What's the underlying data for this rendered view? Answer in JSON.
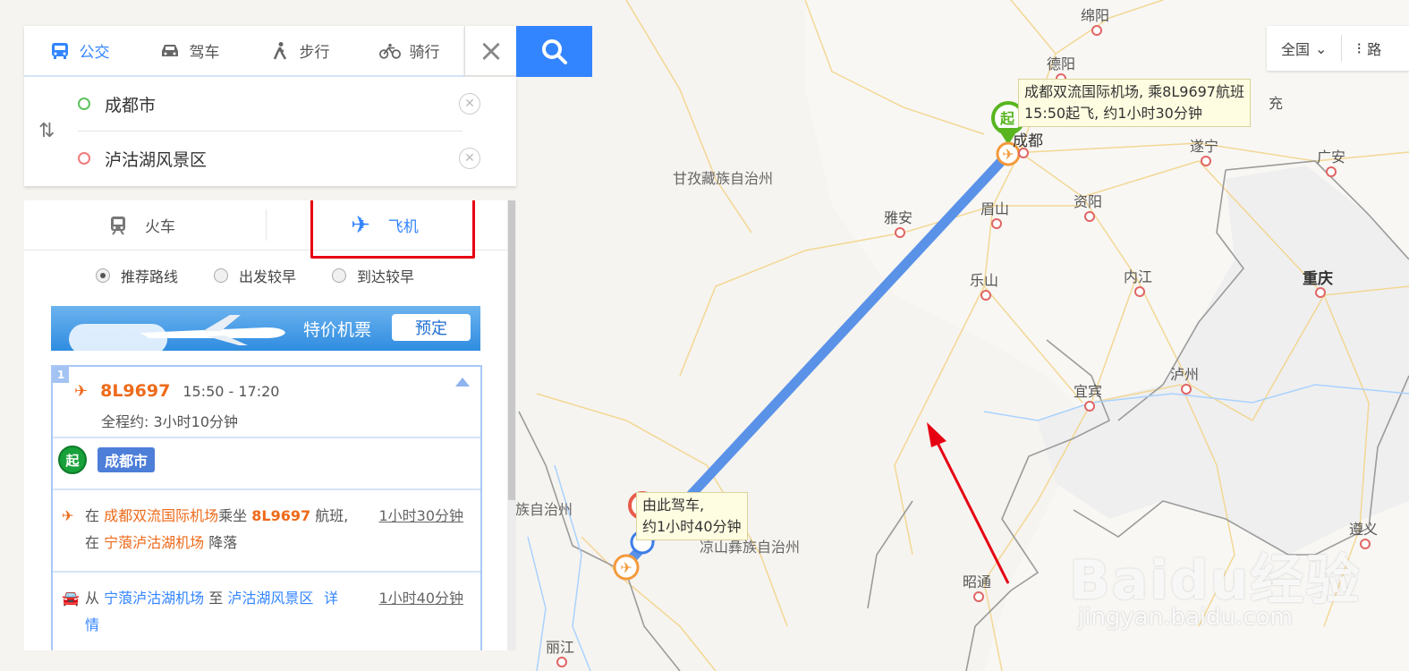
{
  "transport_modes": [
    {
      "label": "公交",
      "icon": "bus-icon",
      "active": true
    },
    {
      "label": "驾车",
      "icon": "car-icon",
      "active": false
    },
    {
      "label": "步行",
      "icon": "walk-icon",
      "active": false
    },
    {
      "label": "骑行",
      "icon": "bike-icon",
      "active": false
    }
  ],
  "route": {
    "start": "成都市",
    "end": "泸沽湖风景区"
  },
  "sub_tabs": {
    "train": "火车",
    "plane": "飞机"
  },
  "sort_options": [
    {
      "label": "推荐路线",
      "checked": true
    },
    {
      "label": "出发较早",
      "checked": false
    },
    {
      "label": "到达较早",
      "checked": false
    }
  ],
  "banner": {
    "text": "特价机票",
    "button": "预定"
  },
  "plan": {
    "index": "1",
    "flight_no": "8L9697",
    "time_range": "15:50 - 17:20",
    "duration": "全程约: 3小时10分钟",
    "start_badge": "起",
    "start_city": "成都市",
    "step1": {
      "p1": "在",
      "airport_from": "成都双流国际机场",
      "p2": "乘坐",
      "flight": "8L9697",
      "p3": "航班,",
      "p4": "在",
      "airport_to": "宁蒗泸沽湖机场",
      "p5": "降落",
      "duration": "1小时30分钟"
    },
    "step2": {
      "p1": "从",
      "from": "宁蒗泸沽湖机场",
      "p2": "至",
      "to": "泸沽湖风景区",
      "detail": "详情",
      "duration": "1小时40分钟"
    }
  },
  "map_labels": {
    "cities": [
      "绵阳",
      "德阳",
      "成都",
      "遂宁",
      "广安",
      "资阳",
      "眉山",
      "雅安",
      "乐山",
      "内江",
      "重庆",
      "宜宾",
      "泸州",
      "昭通",
      "遵义",
      "丽江",
      "充"
    ],
    "regions": [
      "甘孜藏族自治州",
      "凉山彝族自治州",
      "族自治州"
    ]
  },
  "popups": {
    "start": [
      "成都双流国际机场, 乘8L9697航班",
      "15:50起飞, 约1小时30分钟"
    ],
    "start_marker": "起",
    "end": [
      "由此驾车,",
      "约1小时40分钟"
    ]
  },
  "top_right": {
    "region": "全国",
    "road": "路"
  },
  "watermark": {
    "main": "Baidu经验",
    "sub": "jingyan.baidu.com"
  }
}
